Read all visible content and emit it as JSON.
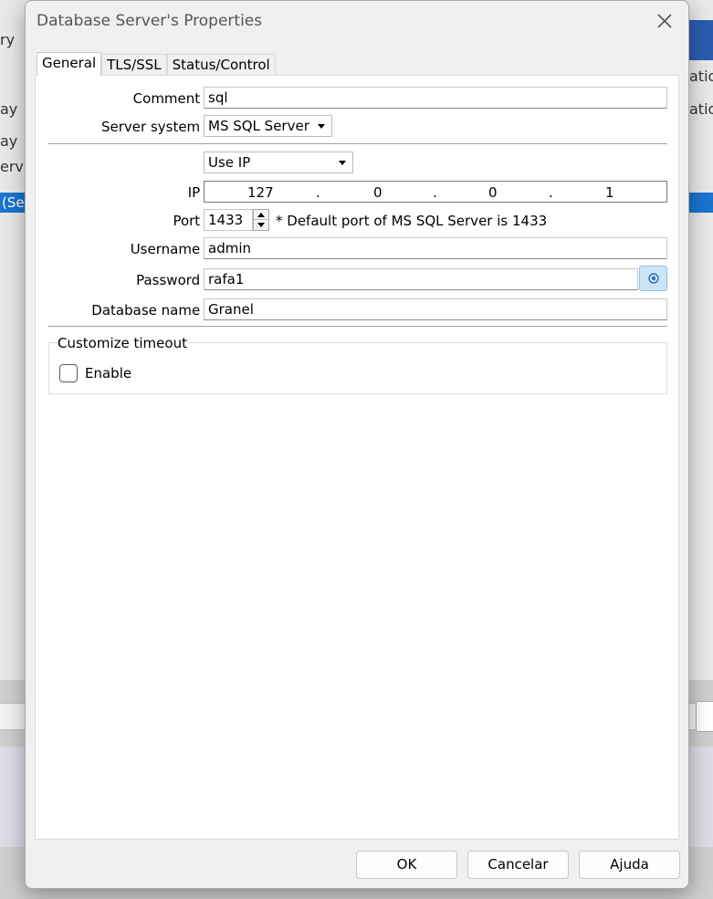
{
  "background": {
    "fragments": [
      "ry",
      "ay",
      "ay",
      "erve",
      "atio",
      "atio"
    ],
    "selected_row_text": "(Se"
  },
  "dialog": {
    "title": "Database Server's Properties",
    "close_glyph": "✕",
    "tabs": [
      {
        "label": "General",
        "active": true
      },
      {
        "label": "TLS/SSL",
        "active": false
      },
      {
        "label": "Status/Control",
        "active": false
      }
    ],
    "form": {
      "comment_label": "Comment :",
      "comment_value": "sql",
      "server_system_label": "Server system :",
      "server_system_value": "MS SQL Server",
      "address_mode_value": "Use IP",
      "ip_label": "IP :",
      "ip_octets": [
        "127",
        "0",
        "0",
        "1"
      ],
      "ip_dot": ".",
      "port_label": "Port :",
      "port_value": "1433",
      "port_note": "* Default port of MS SQL Server is 1433",
      "username_label": "Username :",
      "username_value": "admin",
      "password_label": "Password :",
      "password_value": "rafa1",
      "database_label": "Database name :",
      "database_value": "Granel"
    },
    "timeout": {
      "group_title": "Customize timeout",
      "enable_label": "Enable",
      "enabled": false
    },
    "buttons": {
      "ok": "OK",
      "cancel": "Cancelar",
      "help": "Ajuda"
    }
  },
  "colors": {
    "selection": "#1b74d0",
    "accent_button": "#cde4f7"
  }
}
